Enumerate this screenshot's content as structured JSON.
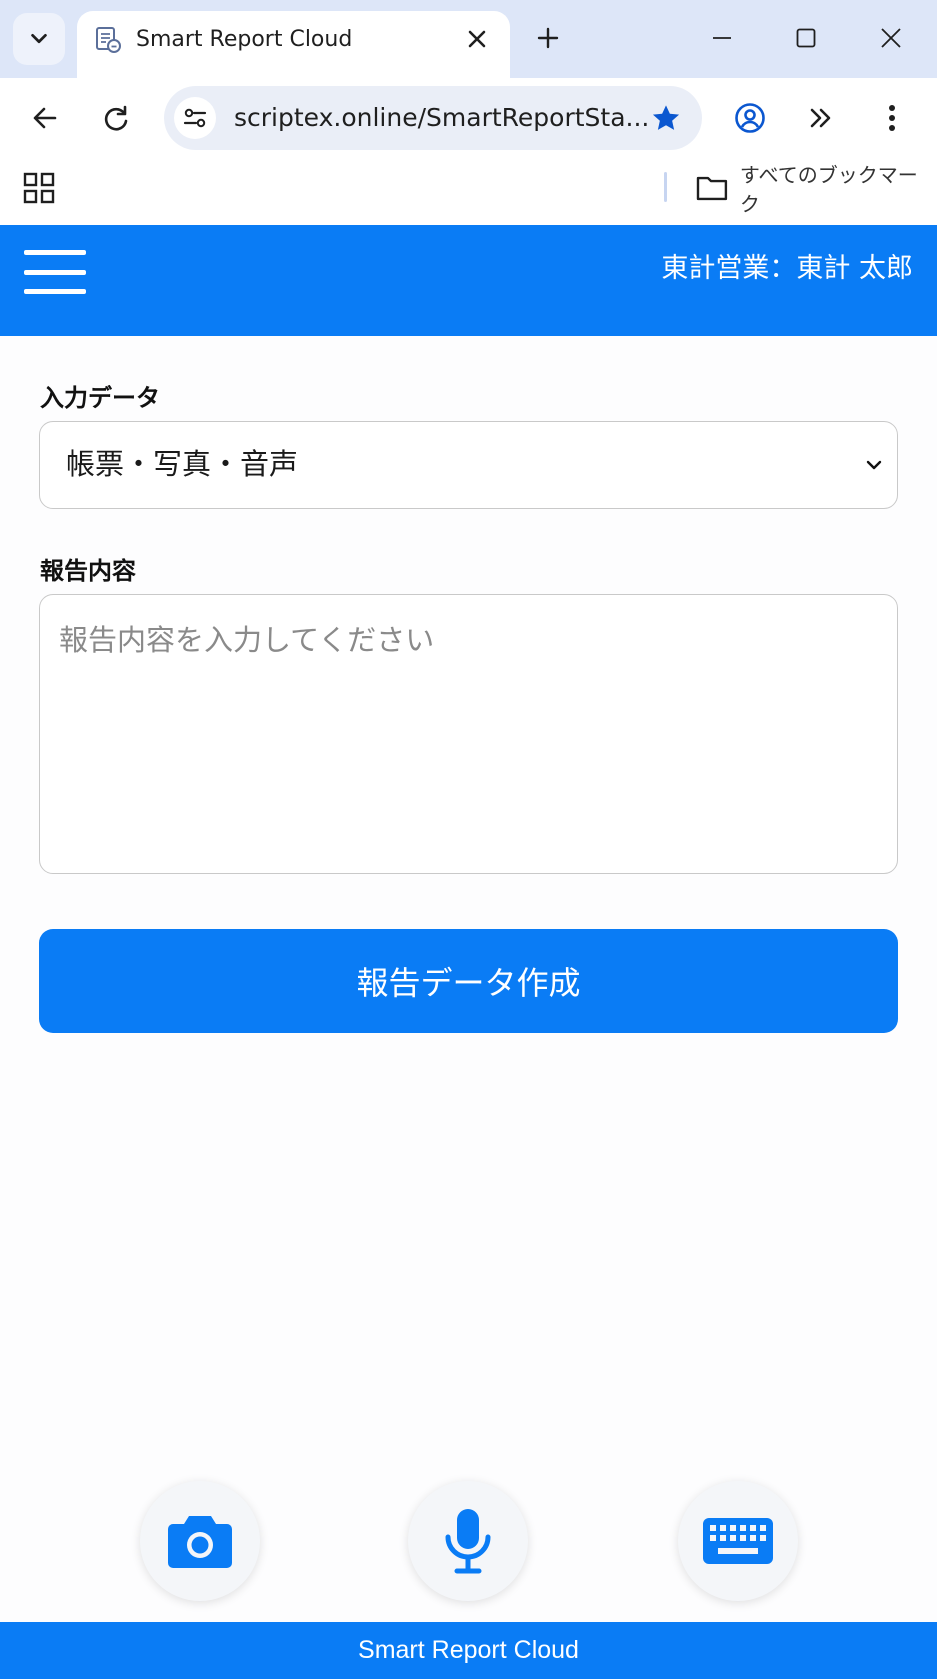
{
  "browser": {
    "tab_title": "Smart Report Cloud",
    "url": "scriptex.online/SmartReportSta...",
    "bookmarks_label": "すべてのブックマーク",
    "icons": {
      "tab_dropdown": "chevron-down-icon",
      "favicon": "report-cloud-icon",
      "close": "close-icon",
      "new_tab": "plus-icon",
      "minimize": "minimize-icon",
      "maximize": "maximize-icon",
      "window_close": "close-icon",
      "back": "arrow-left-icon",
      "reload": "reload-icon",
      "site_info": "tune-icon",
      "bookmark_star": "star-icon",
      "profile": "profile-icon",
      "extensions": "double-chevron-icon",
      "menu": "kebab-icon",
      "apps": "apps-grid-icon",
      "folder": "folder-icon"
    },
    "accent_color": "#0b57d0"
  },
  "app": {
    "header": {
      "user_label": "東計営業：東計 太郎",
      "menu_icon": "hamburger-icon"
    },
    "form": {
      "input_data_label": "入力データ",
      "input_data_value": "帳票・写真・音声",
      "report_label": "報告内容",
      "report_placeholder": "報告内容を入力してください",
      "submit_label": "報告データ作成"
    },
    "actions": [
      {
        "name": "camera-icon"
      },
      {
        "name": "microphone-icon"
      },
      {
        "name": "keyboard-icon"
      }
    ],
    "footer": {
      "text": "Smart Report Cloud"
    },
    "brand_color": "#0a7cf5"
  }
}
